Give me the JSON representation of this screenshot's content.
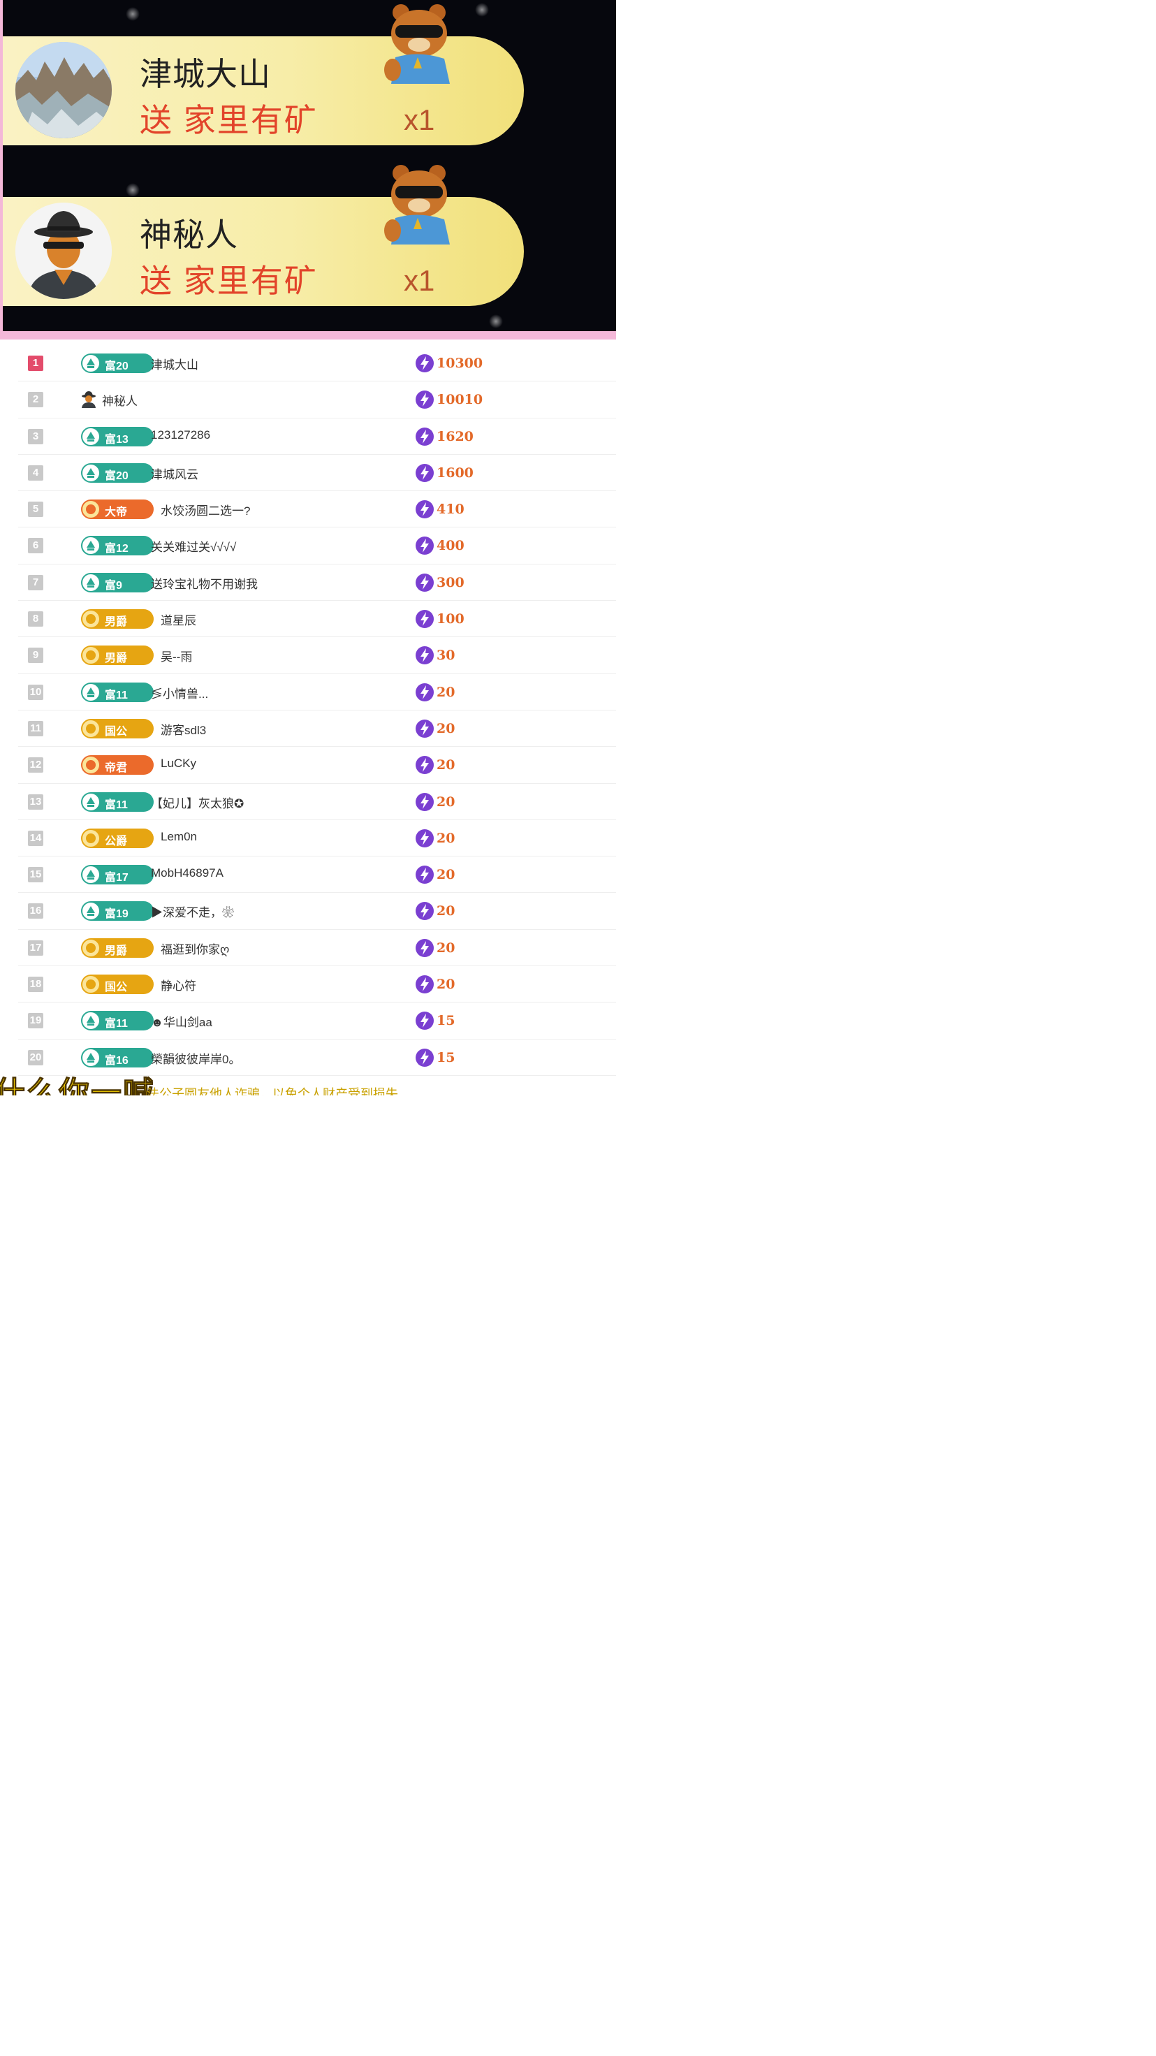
{
  "gifts": [
    {
      "sender": "津城大山",
      "action": "送 家里有矿",
      "count": "x1",
      "avatar": "mountain-avatar"
    },
    {
      "sender": "神秘人",
      "action": "送 家里有矿",
      "count": "x1",
      "avatar": "mystery-man-avatar"
    }
  ],
  "colors": {
    "banner": "#f7eda8",
    "action_text": "#e2442a",
    "score_text": "#e36a2a",
    "divider": "#f4b8d8",
    "rank_first": "#e34c6b"
  },
  "ranking": [
    {
      "rank": "1",
      "badge": "富20",
      "badge_type": "teal",
      "name": "津城大山",
      "score": "10300"
    },
    {
      "rank": "2",
      "badge": "",
      "badge_type": "none",
      "name": "神秘人",
      "score": "10010"
    },
    {
      "rank": "3",
      "badge": "富13",
      "badge_type": "teal",
      "name": "123127286",
      "score": "1620"
    },
    {
      "rank": "4",
      "badge": "富20",
      "badge_type": "teal",
      "name": "津城风云",
      "score": "1600"
    },
    {
      "rank": "5",
      "badge": "大帝",
      "badge_type": "orange",
      "name": "水饺汤圆二选一?",
      "score": "410"
    },
    {
      "rank": "6",
      "badge": "富12",
      "badge_type": "teal",
      "name": "关关难过关√√√√",
      "score": "400"
    },
    {
      "rank": "7",
      "badge": "富9",
      "badge_type": "teal",
      "name": "送玲宝礼物不用谢我",
      "score": "300"
    },
    {
      "rank": "8",
      "badge": "男爵",
      "badge_type": "gold",
      "name": "道星辰",
      "score": "100"
    },
    {
      "rank": "9",
      "badge": "男爵",
      "badge_type": "gold",
      "name": "吴--雨",
      "score": "30"
    },
    {
      "rank": "10",
      "badge": "富11",
      "badge_type": "teal",
      "name": "≶小情兽...",
      "score": "20"
    },
    {
      "rank": "11",
      "badge": "国公",
      "badge_type": "gold",
      "name": "游客sdl3",
      "score": "20"
    },
    {
      "rank": "12",
      "badge": "帝君",
      "badge_type": "orange",
      "name": "LuCKy",
      "score": "20"
    },
    {
      "rank": "13",
      "badge": "富11",
      "badge_type": "teal",
      "name": "【妃儿】灰太狼✪",
      "score": "20"
    },
    {
      "rank": "14",
      "badge": "公爵",
      "badge_type": "gold",
      "name": "Lem0n",
      "score": "20"
    },
    {
      "rank": "15",
      "badge": "富17",
      "badge_type": "teal",
      "name": "MobH46897A",
      "score": "20"
    },
    {
      "rank": "16",
      "badge": "富19",
      "badge_type": "teal",
      "name": "▶深爱不走，❀",
      "score": "20"
    },
    {
      "rank": "17",
      "badge": "男爵",
      "badge_type": "gold",
      "name": "福逛到你家ღ",
      "score": "20"
    },
    {
      "rank": "18",
      "badge": "国公",
      "badge_type": "gold",
      "name": "静心符",
      "score": "20"
    },
    {
      "rank": "19",
      "badge": "富11",
      "badge_type": "teal",
      "name": "☻华山剑aa",
      "score": "15"
    },
    {
      "rank": "20",
      "badge": "富16",
      "badge_type": "teal",
      "name": "榮韻彼彼岸岸0。",
      "score": "15"
    }
  ],
  "subtitle": {
    "big": "什么你一喊",
    "small": "法公子圆友他人诈骗，以免个人财产受到损失"
  }
}
